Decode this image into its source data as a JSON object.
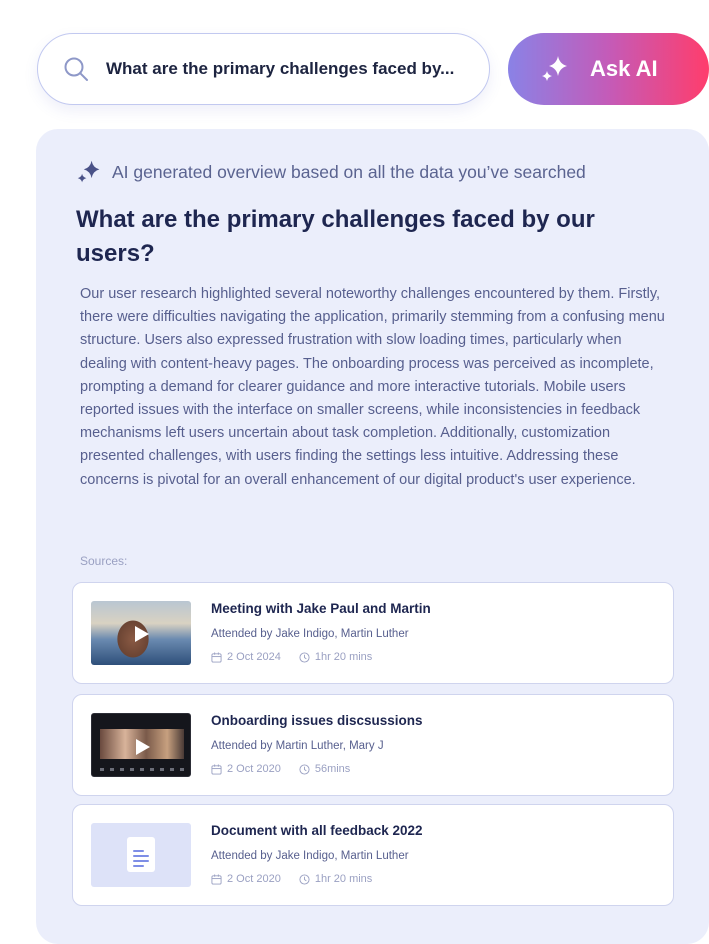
{
  "search": {
    "query": "What are the primary challenges faced by..."
  },
  "ask_button": {
    "label": "Ask AI"
  },
  "overview": {
    "header": "AI generated overview based on all the data you’ve searched",
    "question": "What are the primary challenges faced by our users?",
    "answer": "Our user research highlighted several noteworthy challenges encountered by them. Firstly, there were difficulties navigating the application, primarily stemming from a confusing menu structure. Users also expressed frustration with slow loading times, particularly when dealing with content-heavy pages. The onboarding process was perceived as incomplete, prompting a demand for clearer guidance and more interactive tutorials. Mobile users reported issues with the interface on smaller screens, while inconsistencies in feedback mechanisms left users uncertain about task completion. Additionally, customization presented challenges, with users finding the settings less intuitive. Addressing these concerns is pivotal for an overall enhancement of our digital product's user experience.",
    "sources_label": "Sources:"
  },
  "sources": [
    {
      "title": "Meeting with Jake Paul and Martin",
      "attended": "Attended by Jake Indigo, Martin Luther",
      "date": "2 Oct 2024",
      "duration": "1hr 20 mins",
      "thumb_icon": "play-icon"
    },
    {
      "title": "Onboarding issues discsussions",
      "attended": "Attended by Martin Luther,  Mary J",
      "date": "2 Oct 2020",
      "duration": "56mins",
      "thumb_icon": "play-icon"
    },
    {
      "title": "Document with all feedback 2022",
      "attended": "Attended by Jake Indigo, Martin Luther",
      "date": "2 Oct 2020",
      "duration": "1hr 20 mins",
      "thumb_icon": "document-icon"
    }
  ],
  "colors": {
    "panel_bg": "#ebeefb",
    "title_text": "#1e2650",
    "body_text": "#575f8e",
    "gradient_start": "#8a82e6",
    "gradient_end": "#ff3d6c"
  }
}
